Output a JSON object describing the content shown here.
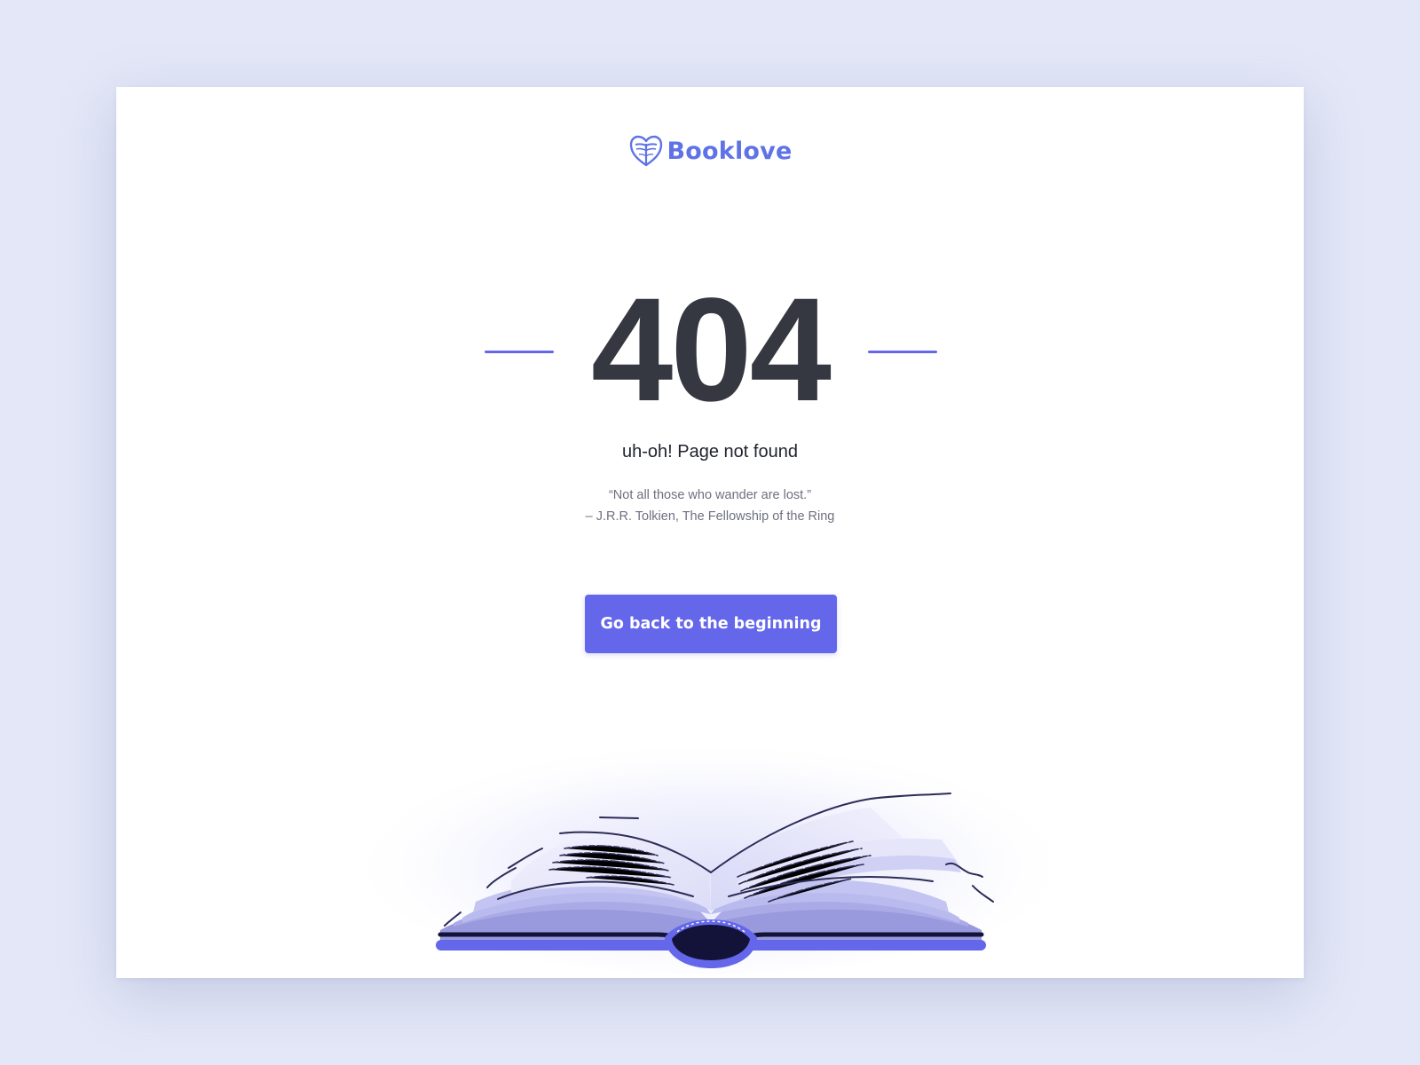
{
  "brand": {
    "name": "Booklove",
    "icon": "book-heart-icon"
  },
  "error": {
    "code": "404",
    "title": "uh-oh! Page not found",
    "quote_line": "“Not all those who wander are lost.”",
    "attribution": "– J.R.R. Tolkien, The Fellowship of the Ring"
  },
  "cta": {
    "label": "Go back to the beginning"
  },
  "illustration": {
    "icon": "open-book-illustration"
  },
  "colors": {
    "background": "#e3e7f7",
    "card": "#ffffff",
    "accent": "#6567ea",
    "brand": "#5f73e6",
    "heading": "#363841",
    "muted_text": "#6e7080",
    "book_dark": "#13133a"
  }
}
